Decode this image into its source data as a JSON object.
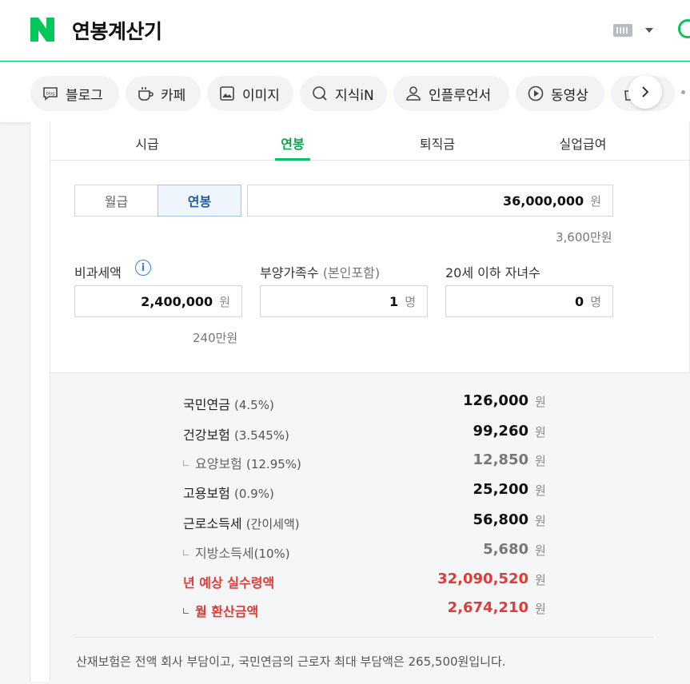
{
  "header": {
    "title": "연봉계산기",
    "logo_letter": "N",
    "brand_color": "#03c75a"
  },
  "category_tabs": [
    {
      "label": "블로그",
      "icon": "blog-icon"
    },
    {
      "label": "카페",
      "icon": "cafe-cup-icon"
    },
    {
      "label": "이미지",
      "icon": "image-icon"
    },
    {
      "label": "지식iN",
      "icon": "kin-icon"
    },
    {
      "label": "인플루언서",
      "icon": "person-icon"
    },
    {
      "label": "동영상",
      "icon": "play-icon"
    }
  ],
  "calculator_tabs": [
    "시급",
    "연봉",
    "퇴직금",
    "실업급여"
  ],
  "active_calculator_tab": "연봉",
  "pay_type": {
    "options": [
      "월급",
      "연봉"
    ],
    "selected": "연봉"
  },
  "salary": {
    "value": "36,000,000",
    "unit": "원",
    "hint": "3,600만원"
  },
  "tax_free": {
    "label": "비과세액",
    "value": "2,400,000",
    "unit": "원",
    "hint": "240만원"
  },
  "dependents": {
    "label": "부양가족수",
    "label_sub": "(본인포함)",
    "value": "1",
    "unit": "명"
  },
  "children": {
    "label": "20세 이하 자녀수",
    "value": "0",
    "unit": "명"
  },
  "results": [
    {
      "name": "국민연금",
      "pct": "(4.5%)",
      "value": "126,000",
      "unit": "원",
      "type": "main"
    },
    {
      "name": "건강보험",
      "pct": "(3.545%)",
      "value": "99,260",
      "unit": "원",
      "type": "main"
    },
    {
      "name": "요양보험",
      "pct": "(12.95%)",
      "value": "12,850",
      "unit": "원",
      "type": "sub"
    },
    {
      "name": "고용보험",
      "pct": "(0.9%)",
      "value": "25,200",
      "unit": "원",
      "type": "main"
    },
    {
      "name": "근로소득세",
      "pct": "(간이세액)",
      "value": "56,800",
      "unit": "원",
      "type": "main"
    },
    {
      "name": "지방소득세",
      "pct": "(10%)",
      "value": "5,680",
      "unit": "원",
      "type": "sub"
    },
    {
      "name": "년 예상 실수령액",
      "pct": "",
      "value": "32,090,520",
      "unit": "원",
      "type": "red"
    },
    {
      "name": "월 환산금액",
      "pct": "",
      "value": "2,674,210",
      "unit": "원",
      "type": "red-sub"
    }
  ],
  "note": "산재보험은 전액 회사 부담이고, 국민연금의 근로자 최대 부담액은 265,500원입니다.",
  "info_icon_text": "i"
}
